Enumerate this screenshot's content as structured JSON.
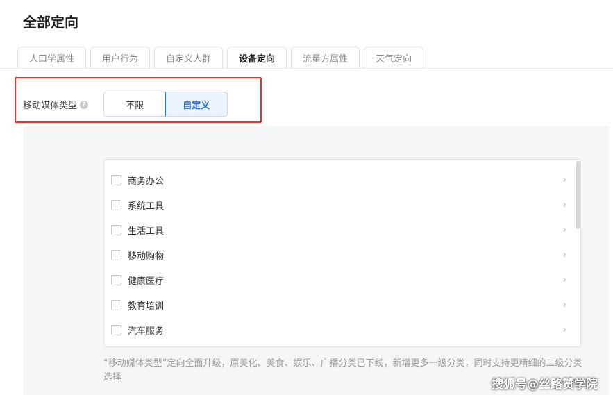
{
  "page_title": "全部定向",
  "tabs": [
    {
      "label": "人口学属性",
      "active": false
    },
    {
      "label": "用户行为",
      "active": false
    },
    {
      "label": "自定义人群",
      "active": false
    },
    {
      "label": "设备定向",
      "active": true
    },
    {
      "label": "流量方属性",
      "active": false
    },
    {
      "label": "天气定向",
      "active": false
    }
  ],
  "media_type": {
    "label": "移动媒体类型",
    "help_icon": "question-circle-icon",
    "options": [
      "不限",
      "自定义"
    ],
    "selected": "自定义"
  },
  "category_list": {
    "items": [
      {
        "label": "商务办公",
        "checked": false
      },
      {
        "label": "系统工具",
        "checked": false
      },
      {
        "label": "生活工具",
        "checked": false
      },
      {
        "label": "移动购物",
        "checked": false
      },
      {
        "label": "健康医疗",
        "checked": false
      },
      {
        "label": "教育培训",
        "checked": false
      },
      {
        "label": "汽车服务",
        "checked": false
      }
    ]
  },
  "notice": "“移动媒体类型”定向全面升级，原美化、美食、娱乐、广播分类已下线，新增更多一级分类，同时支持更精细的二级分类选择",
  "watermark": "搜狐号@丝路赞学院",
  "colors": {
    "highlight_border": "#e8332a",
    "accent_blue": "#1e66d0",
    "panel_bg": "#f5f6f8"
  }
}
